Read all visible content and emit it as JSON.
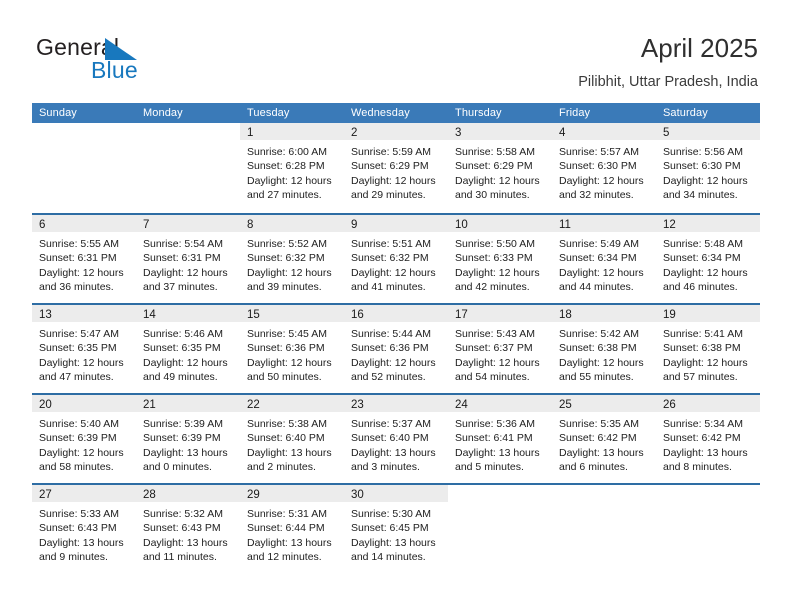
{
  "brand": {
    "name_part1": "General",
    "name_part2": "Blue",
    "triangle_color": "#1878be",
    "logo_icon": "general-blue-triangle-logo"
  },
  "header": {
    "title": "April 2025",
    "subtitle": "Pilibhit, Uttar Pradesh, India"
  },
  "theme": {
    "header_blue": "#3a7ab8",
    "row_separator_blue": "#2e6da4",
    "day_band_gray": "#ececec",
    "brand_blue": "#1878be"
  },
  "calendar": {
    "weekday_headers": [
      "Sunday",
      "Monday",
      "Tuesday",
      "Wednesday",
      "Thursday",
      "Friday",
      "Saturday"
    ],
    "weeks": [
      [
        {
          "day": "",
          "lines": []
        },
        {
          "day": "",
          "lines": []
        },
        {
          "day": "1",
          "lines": [
            "Sunrise: 6:00 AM",
            "Sunset: 6:28 PM",
            "Daylight: 12 hours",
            "and 27 minutes."
          ]
        },
        {
          "day": "2",
          "lines": [
            "Sunrise: 5:59 AM",
            "Sunset: 6:29 PM",
            "Daylight: 12 hours",
            "and 29 minutes."
          ]
        },
        {
          "day": "3",
          "lines": [
            "Sunrise: 5:58 AM",
            "Sunset: 6:29 PM",
            "Daylight: 12 hours",
            "and 30 minutes."
          ]
        },
        {
          "day": "4",
          "lines": [
            "Sunrise: 5:57 AM",
            "Sunset: 6:30 PM",
            "Daylight: 12 hours",
            "and 32 minutes."
          ]
        },
        {
          "day": "5",
          "lines": [
            "Sunrise: 5:56 AM",
            "Sunset: 6:30 PM",
            "Daylight: 12 hours",
            "and 34 minutes."
          ]
        }
      ],
      [
        {
          "day": "6",
          "lines": [
            "Sunrise: 5:55 AM",
            "Sunset: 6:31 PM",
            "Daylight: 12 hours",
            "and 36 minutes."
          ]
        },
        {
          "day": "7",
          "lines": [
            "Sunrise: 5:54 AM",
            "Sunset: 6:31 PM",
            "Daylight: 12 hours",
            "and 37 minutes."
          ]
        },
        {
          "day": "8",
          "lines": [
            "Sunrise: 5:52 AM",
            "Sunset: 6:32 PM",
            "Daylight: 12 hours",
            "and 39 minutes."
          ]
        },
        {
          "day": "9",
          "lines": [
            "Sunrise: 5:51 AM",
            "Sunset: 6:32 PM",
            "Daylight: 12 hours",
            "and 41 minutes."
          ]
        },
        {
          "day": "10",
          "lines": [
            "Sunrise: 5:50 AM",
            "Sunset: 6:33 PM",
            "Daylight: 12 hours",
            "and 42 minutes."
          ]
        },
        {
          "day": "11",
          "lines": [
            "Sunrise: 5:49 AM",
            "Sunset: 6:34 PM",
            "Daylight: 12 hours",
            "and 44 minutes."
          ]
        },
        {
          "day": "12",
          "lines": [
            "Sunrise: 5:48 AM",
            "Sunset: 6:34 PM",
            "Daylight: 12 hours",
            "and 46 minutes."
          ]
        }
      ],
      [
        {
          "day": "13",
          "lines": [
            "Sunrise: 5:47 AM",
            "Sunset: 6:35 PM",
            "Daylight: 12 hours",
            "and 47 minutes."
          ]
        },
        {
          "day": "14",
          "lines": [
            "Sunrise: 5:46 AM",
            "Sunset: 6:35 PM",
            "Daylight: 12 hours",
            "and 49 minutes."
          ]
        },
        {
          "day": "15",
          "lines": [
            "Sunrise: 5:45 AM",
            "Sunset: 6:36 PM",
            "Daylight: 12 hours",
            "and 50 minutes."
          ]
        },
        {
          "day": "16",
          "lines": [
            "Sunrise: 5:44 AM",
            "Sunset: 6:36 PM",
            "Daylight: 12 hours",
            "and 52 minutes."
          ]
        },
        {
          "day": "17",
          "lines": [
            "Sunrise: 5:43 AM",
            "Sunset: 6:37 PM",
            "Daylight: 12 hours",
            "and 54 minutes."
          ]
        },
        {
          "day": "18",
          "lines": [
            "Sunrise: 5:42 AM",
            "Sunset: 6:38 PM",
            "Daylight: 12 hours",
            "and 55 minutes."
          ]
        },
        {
          "day": "19",
          "lines": [
            "Sunrise: 5:41 AM",
            "Sunset: 6:38 PM",
            "Daylight: 12 hours",
            "and 57 minutes."
          ]
        }
      ],
      [
        {
          "day": "20",
          "lines": [
            "Sunrise: 5:40 AM",
            "Sunset: 6:39 PM",
            "Daylight: 12 hours",
            "and 58 minutes."
          ]
        },
        {
          "day": "21",
          "lines": [
            "Sunrise: 5:39 AM",
            "Sunset: 6:39 PM",
            "Daylight: 13 hours",
            "and 0 minutes."
          ]
        },
        {
          "day": "22",
          "lines": [
            "Sunrise: 5:38 AM",
            "Sunset: 6:40 PM",
            "Daylight: 13 hours",
            "and 2 minutes."
          ]
        },
        {
          "day": "23",
          "lines": [
            "Sunrise: 5:37 AM",
            "Sunset: 6:40 PM",
            "Daylight: 13 hours",
            "and 3 minutes."
          ]
        },
        {
          "day": "24",
          "lines": [
            "Sunrise: 5:36 AM",
            "Sunset: 6:41 PM",
            "Daylight: 13 hours",
            "and 5 minutes."
          ]
        },
        {
          "day": "25",
          "lines": [
            "Sunrise: 5:35 AM",
            "Sunset: 6:42 PM",
            "Daylight: 13 hours",
            "and 6 minutes."
          ]
        },
        {
          "day": "26",
          "lines": [
            "Sunrise: 5:34 AM",
            "Sunset: 6:42 PM",
            "Daylight: 13 hours",
            "and 8 minutes."
          ]
        }
      ],
      [
        {
          "day": "27",
          "lines": [
            "Sunrise: 5:33 AM",
            "Sunset: 6:43 PM",
            "Daylight: 13 hours",
            "and 9 minutes."
          ]
        },
        {
          "day": "28",
          "lines": [
            "Sunrise: 5:32 AM",
            "Sunset: 6:43 PM",
            "Daylight: 13 hours",
            "and 11 minutes."
          ]
        },
        {
          "day": "29",
          "lines": [
            "Sunrise: 5:31 AM",
            "Sunset: 6:44 PM",
            "Daylight: 13 hours",
            "and 12 minutes."
          ]
        },
        {
          "day": "30",
          "lines": [
            "Sunrise: 5:30 AM",
            "Sunset: 6:45 PM",
            "Daylight: 13 hours",
            "and 14 minutes."
          ]
        },
        {
          "day": "",
          "lines": []
        },
        {
          "day": "",
          "lines": []
        },
        {
          "day": "",
          "lines": []
        }
      ]
    ]
  }
}
